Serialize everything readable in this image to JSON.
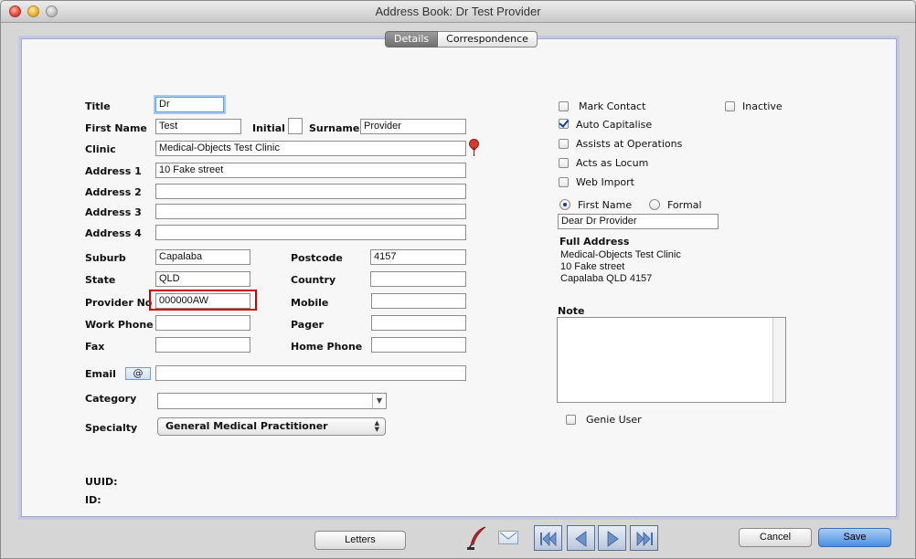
{
  "window": {
    "title": "Address Book: Dr Test Provider"
  },
  "tabs": [
    "Details",
    "Correspondence"
  ],
  "labels": {
    "title": "Title",
    "first_name": "First Name",
    "initial": "Initial",
    "surname": "Surname",
    "clinic": "Clinic",
    "address1": "Address 1",
    "address2": "Address 2",
    "address3": "Address 3",
    "address4": "Address 4",
    "suburb": "Suburb",
    "postcode": "Postcode",
    "state": "State",
    "country": "Country",
    "provider_no": "Provider No",
    "mobile": "Mobile",
    "work_phone": "Work Phone",
    "pager": "Pager",
    "fax": "Fax",
    "home_phone": "Home Phone",
    "email": "Email",
    "category": "Category",
    "specialty": "Specialty",
    "uuid": "UUID:",
    "id": "ID:"
  },
  "values": {
    "title": "Dr",
    "first_name": "Test",
    "initial": "",
    "surname": "Provider",
    "clinic": "Medical-Objects Test Clinic",
    "address1": "10 Fake street",
    "address2": "",
    "address3": "",
    "address4": "",
    "suburb": "Capalaba",
    "postcode": "4157",
    "state": "QLD",
    "country": "",
    "provider_no": "000000AW",
    "mobile": "",
    "work_phone": "",
    "pager": "",
    "fax": "",
    "home_phone": "",
    "email": "",
    "category": "",
    "specialty": "General Medical Practitioner"
  },
  "email_icon_text": "@",
  "checkboxes": {
    "mark_contact": {
      "label": "Mark Contact",
      "checked": false
    },
    "inactive": {
      "label": "Inactive",
      "checked": false
    },
    "auto_capitalise": {
      "label": "Auto Capitalise",
      "checked": true
    },
    "assists_at_operations": {
      "label": "Assists at Operations",
      "checked": false
    },
    "acts_as_locum": {
      "label": "Acts as Locum",
      "checked": false
    },
    "web_import": {
      "label": "Web Import",
      "checked": false
    },
    "genie_user": {
      "label": "Genie User",
      "checked": false
    }
  },
  "salutation": {
    "first_name_label": "First Name",
    "formal_label": "Formal",
    "selected": "First Name",
    "value": "Dear Dr Provider"
  },
  "full_address": {
    "heading": "Full Address",
    "lines": [
      "Medical-Objects Test Clinic",
      "10 Fake street",
      "Capalaba QLD 4157"
    ]
  },
  "note": {
    "heading": "Note",
    "value": ""
  },
  "footer": {
    "letters": "Letters",
    "cancel": "Cancel",
    "save": "Save"
  },
  "icons": {
    "pin": "map-pin-icon",
    "email": "email-at-icon",
    "quill": "quill-pen-icon",
    "envelope": "envelope-icon",
    "first": "first-record-icon",
    "prev": "previous-record-icon",
    "next": "next-record-icon",
    "last": "last-record-icon"
  },
  "colors": {
    "highlight_border": "#d00000",
    "default_button": "#4a8fe0",
    "panel_border": "#c6c6e6"
  }
}
